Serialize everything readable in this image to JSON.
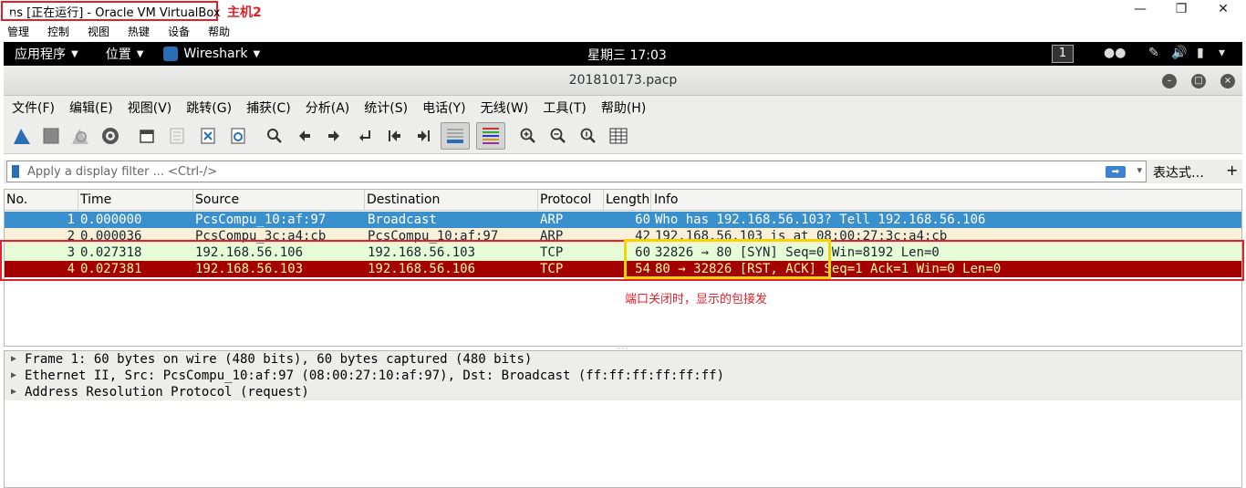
{
  "vbox": {
    "title": "ns [正在运行] - Oracle VM VirtualBox",
    "annotation": "主机2",
    "controls": {
      "minimize": "—",
      "restore": "❐",
      "close": "✕"
    },
    "menu": [
      "管理",
      "控制",
      "视图",
      "热键",
      "设备",
      "帮助"
    ]
  },
  "gnome": {
    "apps": "应用程序",
    "places": "位置",
    "active_app": "Wireshark",
    "clock": "星期三 17:03",
    "workspace": "1"
  },
  "wireshark": {
    "window_title": "201810173.pacp",
    "menu": [
      "文件(F)",
      "编辑(E)",
      "视图(V)",
      "跳转(G)",
      "捕获(C)",
      "分析(A)",
      "统计(S)",
      "电话(Y)",
      "无线(W)",
      "工具(T)",
      "帮助(H)"
    ],
    "filter": {
      "placeholder": "Apply a display filter ... <Ctrl-/>",
      "expression_label": "表达式…",
      "add_label": "+"
    },
    "columns": [
      "No.",
      "Time",
      "Source",
      "Destination",
      "Protocol",
      "Length",
      "Info"
    ],
    "packets": [
      {
        "no": "1",
        "time": "0.000000",
        "source": "PcsCompu_10:af:97",
        "destination": "Broadcast",
        "protocol": "ARP",
        "length": "60",
        "info": "Who has 192.168.56.103? Tell 192.168.56.106"
      },
      {
        "no": "2",
        "time": "0.000036",
        "source": "PcsCompu_3c:a4:cb",
        "destination": "PcsCompu_10:af:97",
        "protocol": "ARP",
        "length": "42",
        "info": "192.168.56.103 is at 08:00:27:3c:a4:cb"
      },
      {
        "no": "3",
        "time": "0.027318",
        "source": "192.168.56.106",
        "destination": "192.168.56.103",
        "protocol": "TCP",
        "length": "60",
        "info": "32826 → 80 [SYN] Seq=0 Win=8192 Len=0"
      },
      {
        "no": "4",
        "time": "0.027381",
        "source": "192.168.56.103",
        "destination": "192.168.56.106",
        "protocol": "TCP",
        "length": "54",
        "info": "80 → 32826 [RST, ACK] Seq=1 Ack=1 Win=0 Len=0"
      }
    ],
    "row_colors": {
      "selected_bg": "#3a8fcd",
      "selected_fg": "#ffffff",
      "arp_bg": "#faf0d7",
      "arp_fg": "#12272e",
      "syn_bg": "#e7fcd6",
      "syn_fg": "#12272e",
      "rst_bg": "#a40000",
      "rst_fg": "#fffc9c"
    },
    "annotation_note": "端口关闭时，显示的包接发",
    "details": [
      "Frame 1: 60 bytes on wire (480 bits), 60 bytes captured (480 bits)",
      "Ethernet II, Src: PcsCompu_10:af:97 (08:00:27:10:af:97), Dst: Broadcast (ff:ff:ff:ff:ff:ff)",
      "Address Resolution Protocol (request)"
    ]
  }
}
